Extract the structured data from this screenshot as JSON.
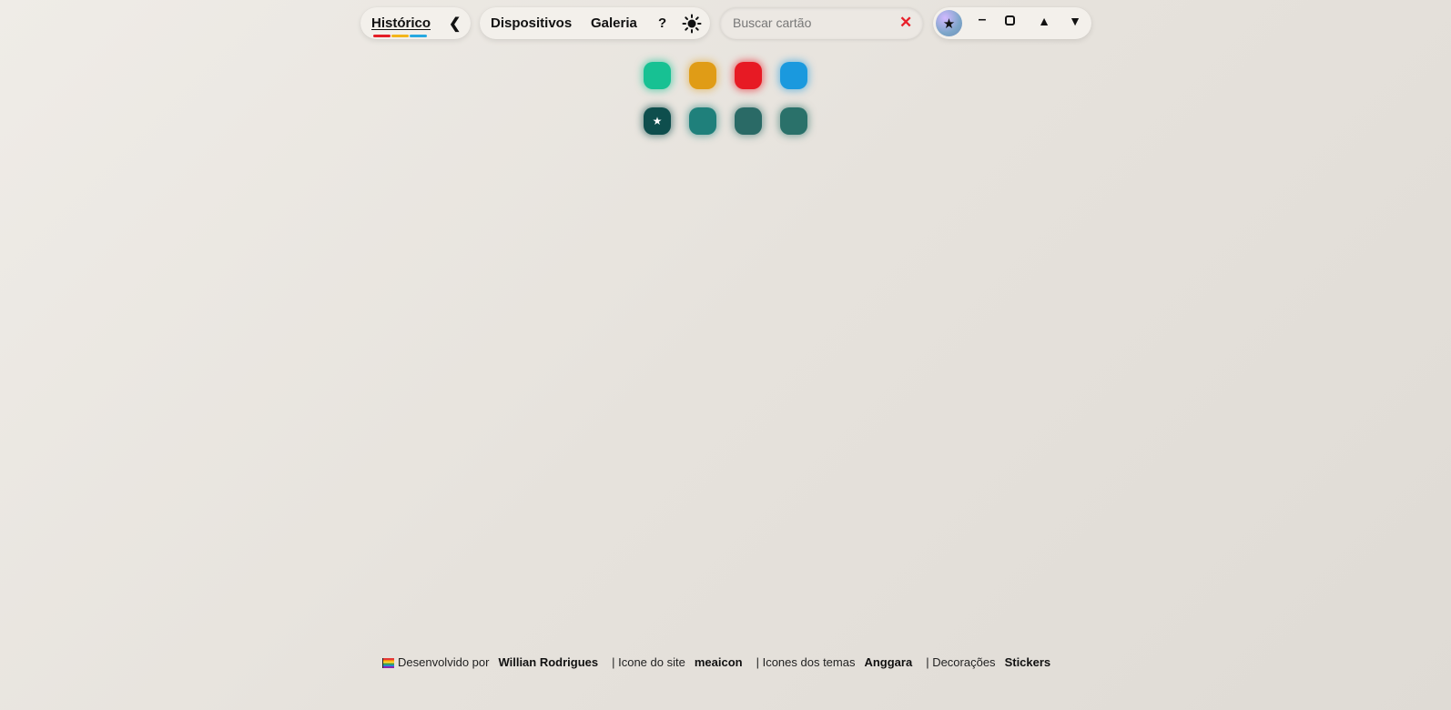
{
  "header": {
    "history_label": "Histórico",
    "history_underline_colors": [
      "#e41e26",
      "#f3b51b",
      "#27a9e1"
    ],
    "collapse_icon": "chevron-left-icon",
    "collapse_glyph": "❮",
    "nav": {
      "devices_label": "Dispositivos",
      "gallery_label": "Galeria",
      "help_label": "?",
      "theme_icon": "sun-icon"
    },
    "search": {
      "placeholder": "Buscar cartão",
      "value": "",
      "clear_glyph": "✕",
      "clear_color": "#e8202a"
    },
    "window": {
      "avatar_glyph": "★",
      "minimize_glyph": "–",
      "up_glyph": "▲",
      "down_glyph": "▼"
    }
  },
  "palette": {
    "row1": [
      {
        "name": "green",
        "color": "#17c193",
        "glow": "rgba(23,193,147,0.55)"
      },
      {
        "name": "orange",
        "color": "#e09c16",
        "glow": "rgba(224,156,22,0.45)"
      },
      {
        "name": "red",
        "color": "#e71a24",
        "glow": "rgba(231,26,36,0.55)"
      },
      {
        "name": "blue",
        "color": "#1a99de",
        "glow": "rgba(26,153,222,0.50)"
      }
    ],
    "row2": [
      {
        "name": "teal-dark-active",
        "color": "#0e4e4d",
        "glow": "rgba(14,78,77,0.55)",
        "selected": true,
        "star": "★"
      },
      {
        "name": "teal-split",
        "color": "#1f807b",
        "glow": "rgba(31,128,123,0.50)"
      },
      {
        "name": "teal-muted",
        "color": "#2a6a66",
        "glow": "rgba(42,106,102,0.50)"
      },
      {
        "name": "teal-split-2",
        "color": "#2a716a",
        "glow": "rgba(42,113,106,0.50)"
      }
    ]
  },
  "footer": {
    "dev_prefix": "Desenvolvido por",
    "dev_name": "Willian Rodrigues",
    "icon_prefix": "| Icone do site",
    "icon_name": "meaicon",
    "themes_prefix": "| Icones dos temas",
    "themes_name": "Anggara",
    "deco_prefix": "| Decorações",
    "deco_name": "Stickers"
  }
}
